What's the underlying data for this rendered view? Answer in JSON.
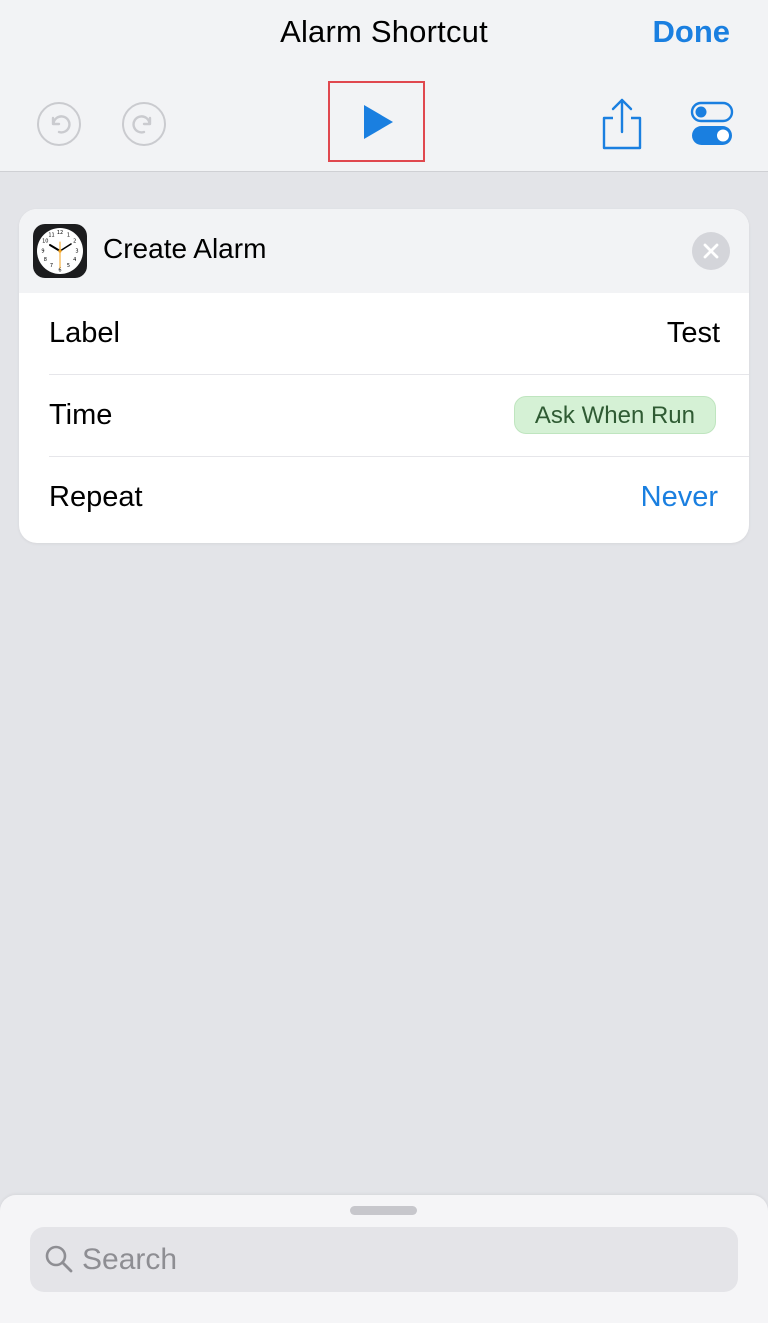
{
  "header": {
    "title": "Alarm Shortcut",
    "done_label": "Done"
  },
  "toolbar": {
    "icons": [
      "undo-icon",
      "redo-icon",
      "play-icon",
      "share-icon",
      "settings-toggle-icon"
    ]
  },
  "action": {
    "title": "Create Alarm",
    "app_icon": "clock-icon",
    "rows": [
      {
        "label": "Label",
        "value": "Test"
      },
      {
        "label": "Time",
        "value": "Ask When Run"
      },
      {
        "label": "Repeat",
        "value": "Never"
      }
    ]
  },
  "search": {
    "placeholder": "Search",
    "value": ""
  },
  "colors": {
    "accent": "#1a7fe0",
    "highlight_border": "#e0484e",
    "pill_bg": "#d5f1d5",
    "pill_text": "#2f5b33"
  }
}
